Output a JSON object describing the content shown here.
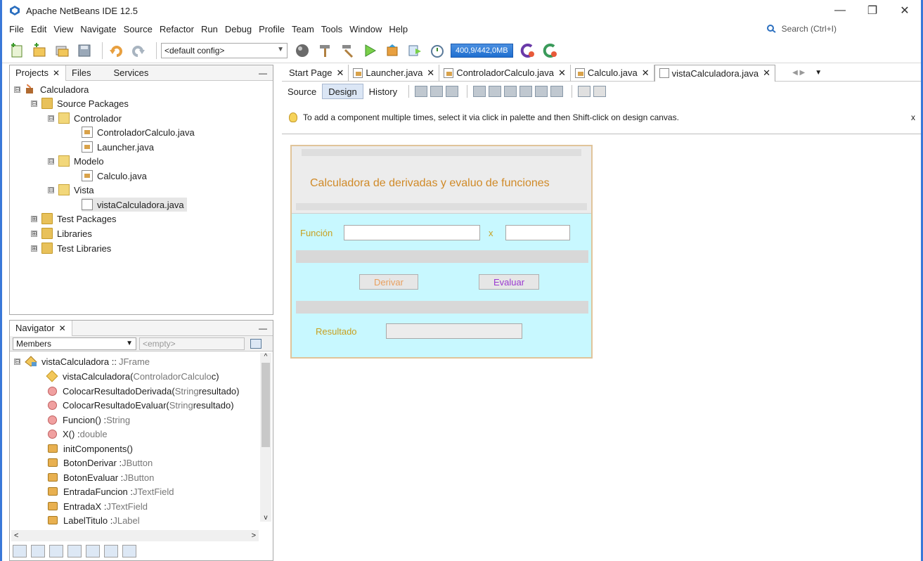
{
  "window": {
    "title": "Apache NetBeans IDE 12.5",
    "minimize": "—",
    "maximize": "❐",
    "close": "✕"
  },
  "menu": [
    "File",
    "Edit",
    "View",
    "Navigate",
    "Source",
    "Refactor",
    "Run",
    "Debug",
    "Profile",
    "Team",
    "Tools",
    "Window",
    "Help"
  ],
  "search": {
    "placeholder": "Search (Ctrl+I)"
  },
  "toolbar": {
    "config": "<default config>",
    "memory": "400,9/442,0MB"
  },
  "projects_panel": {
    "tabs": [
      "Projects",
      "Files",
      "Services"
    ],
    "close_glyph": "✕",
    "minimize_glyph": "—",
    "tree": [
      {
        "label": "Calculadora",
        "expander": "⊟"
      },
      {
        "label": "Source Packages",
        "expander": "⊟"
      },
      {
        "label": "Controlador",
        "expander": "⊟"
      },
      {
        "label": "ControladorCalculo.java"
      },
      {
        "label": "Launcher.java"
      },
      {
        "label": "Modelo",
        "expander": "⊟"
      },
      {
        "label": "Calculo.java"
      },
      {
        "label": "Vista",
        "expander": "⊟"
      },
      {
        "label": "vistaCalculadora.java"
      },
      {
        "label": "Test Packages",
        "expander": "⊞"
      },
      {
        "label": "Libraries",
        "expander": "⊞"
      },
      {
        "label": "Test Libraries",
        "expander": "⊞"
      }
    ]
  },
  "navigator": {
    "title": "Navigator",
    "close_glyph": "✕",
    "minimize_glyph": "—",
    "filter_selected": "Members",
    "filter_empty": "<empty>",
    "root": "vistaCalculadora :: ",
    "root_type": "JFrame",
    "members": [
      {
        "name": "vistaCalculadora(",
        "param": "ControladorCalculo",
        "rest": " c)"
      },
      {
        "name": "ColocarResultadoDerivada(",
        "param": "String",
        "rest": " resultado)"
      },
      {
        "name": "ColocarResultadoEvaluar(",
        "param": "String",
        "rest": " resultado)"
      },
      {
        "name": "Funcion() : ",
        "type": "String"
      },
      {
        "name": "X() : ",
        "type": "double"
      },
      {
        "name": "initComponents()"
      },
      {
        "name": "BotonDerivar : ",
        "type": "JButton"
      },
      {
        "name": "BotonEvaluar : ",
        "type": "JButton"
      },
      {
        "name": "EntradaFuncion : ",
        "type": "JTextField"
      },
      {
        "name": "EntradaX : ",
        "type": "JTextField"
      },
      {
        "name": "LabelTitulo : ",
        "type": "JLabel"
      }
    ],
    "scroll_left": "<",
    "scroll_right": ">",
    "scroll_up": "^",
    "scroll_down": "v"
  },
  "editor": {
    "tabs": [
      "Start Page",
      "Launcher.java",
      "ControladorCalculo.java",
      "Calculo.java",
      "vistaCalculadora.java"
    ],
    "close_glyph": "✕",
    "subtabs": [
      "Source",
      "Design",
      "History"
    ],
    "hint": "To add a component multiple times, select it via click in palette and then Shift-click on design canvas.",
    "hint_close": "x"
  },
  "form": {
    "title": "Calculadora de derivadas y evaluo de funciones",
    "funcion_label": "Función",
    "x_label": "x",
    "derivar": "Derivar",
    "evaluar": "Evaluar",
    "resultado_label": "Resultado"
  }
}
